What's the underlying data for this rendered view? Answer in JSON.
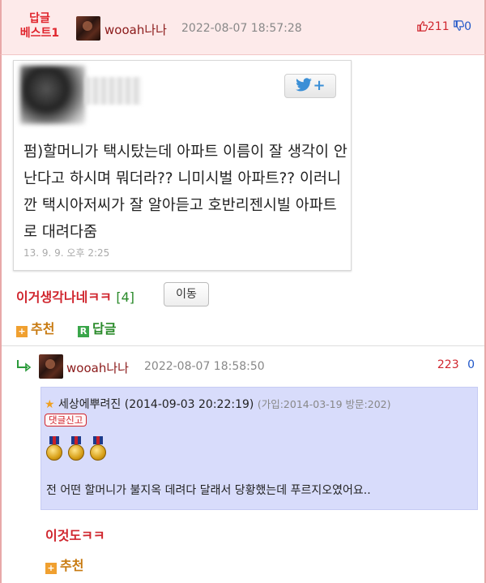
{
  "post": {
    "best_badge_line1": "답글",
    "best_badge_line2": "베스트1",
    "nickname": "wooah나나",
    "date": "2022-08-07 18:57:28",
    "upvotes": "211",
    "downvotes": "0",
    "title": "이거생각나네ㅋㅋ",
    "reply_count": "[4]",
    "move_label": "이동",
    "recommend_label": "추천",
    "reply_label": "답글"
  },
  "tweet": {
    "text": "펌)할머니가 택시탔는데 아파트 이름이 잘 생각이 안난다고 하시며 뭐더라?? 니미시벌 아파트?? 이러니깐 택시아저씨가 잘 알아듣고 호반리젠시빌 아파트로 대려다줌",
    "date": "13. 9. 9. 오후 2:25",
    "twitter_button": "+"
  },
  "reply": {
    "nickname": "wooah나나",
    "date": "2022-08-07 18:58:50",
    "upvotes": "223",
    "downvotes": "0",
    "quote": {
      "author": "세상에뿌려진",
      "datetime": "(2014-09-03 20:22:19)",
      "meta": "(가입:2014-03-19 방문:202)",
      "report_label": "댓글신고",
      "text": "전 어떤 할머니가 불지옥 데려다 달래서 당황했는데 푸르지오였어요.."
    },
    "title": "이것도ㅋㅋ",
    "recommend_label": "추천"
  },
  "colors": {
    "header_bg": "#fdeaea",
    "accent_red": "#d0262e",
    "quote_bg": "#d8dcfb",
    "recommend_orange": "#c87a10",
    "reply_green": "#2a8a2a"
  }
}
